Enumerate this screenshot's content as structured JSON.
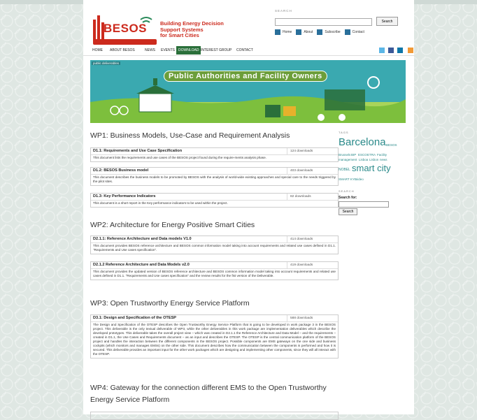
{
  "header": {
    "logo_text": "BESOS",
    "tagline_lines": [
      "Building Energy Decision",
      "Support Systems",
      "for Smart Cities"
    ],
    "search_label": "SEARCH",
    "search_button": "Search",
    "links": [
      "Home",
      "About",
      "Subscribe",
      "Contact"
    ]
  },
  "nav": {
    "items": [
      "HOME",
      "ABOUT BESOS",
      "NEWS",
      "EVENTS",
      "DOWNLOAD",
      "INTEREST GROUP",
      "CONTACT"
    ],
    "active": "DOWNLOAD"
  },
  "banner": {
    "breadcrumb": "public deliverables",
    "title": "Public Authorities and Facility Owners"
  },
  "sections": [
    {
      "heading": "WP1: Business Models, Use-Case and Requirement Analysis",
      "docs": [
        {
          "title": "D1.1: Requirements and Use Case Specification",
          "downloads": "124 downloads",
          "desc": "This document lists the requirements and use cases of the BESOS project found during the require-ments analysis phase."
        },
        {
          "title": "D1.2: BESOS Business model",
          "downloads": "403 downloads",
          "desc": "This document describes the business models to be promoted by BESOS with the analysis of world-wide existing approaches and special care to the needs triggered by the pilot sites."
        },
        {
          "title": "D1.3: Key Performance Indicators",
          "downloads": "82 downloads",
          "desc": "This document is a short report in the Key performance indicators to be used within the project."
        }
      ]
    },
    {
      "heading": "WP2: Architecture for Energy Positive Smart Cities",
      "docs": [
        {
          "title": "D2.1.1: Reference Architecture and Data models V1.0",
          "downloads": "414 downloads",
          "desc": "This document provides BESOS reference architecture and BESOS common information model taking into account requirements and related use cases defined in D1.1. \"Requirements and Use cases specification\"."
        },
        {
          "title": "D2.1.2 Reference Architecture and Data Models v2.0",
          "downloads": "419 downloads",
          "desc": "This document provides the updated version of BESOS reference architecture and BESOS common information model taking into account requirements and related use cases defined in D1.1. \"Requirements and Use cases specification\" and the review results for the fist version of the Deliverable."
        }
      ]
    },
    {
      "heading": "WP3: Open Trustworthy Energy Service Platform",
      "docs": [
        {
          "title": "D3.1: Design and Specification of the OTESP",
          "downloads": "588 downloads",
          "desc": "The Design and Specification of the OTESP describes the Open Trustworthy Energy Service Platform that is going to be developed in work package 3 in the BESOS project. This deliverable is the only textual deliverable of WP3, while the other deliverables in this work package are implementation deliverables which describe the developed prototypes. This deliverable takes the overall project view – which was created in D2.1.1 the Reference Architecture and Data Model – and the requirements – created in D1.1, the Use Cases and Requirements document – as an input and describes the OTESP. The OTESP is the central communication platform of the BESOS project and handles the interaction between the different components in the BESOS project. Possible components are EMS gateways on the one side and business cockpits (which monitors and manages EMSs) on the other side. This document describes how the communication between the components is performed and how it is secured. This deliverable provides an important input for the other work packages which are designing and implementing other components, since they will all interact with the OTESP."
        }
      ]
    },
    {
      "heading_lines": [
        "WP4: Gateway for the connection different EMS to the Open Trustworthy",
        "Energy Service Platform"
      ]
    }
  ],
  "sidebar": {
    "tags_heading": "TAGS",
    "tags": [
      {
        "text": "Barcelona",
        "size": "big"
      },
      {
        "text": "BESOS",
        "size": "small"
      },
      {
        "text": "Brussels",
        "size": "small"
      },
      {
        "text": "BIP",
        "size": "small"
      },
      {
        "text": "ESCO",
        "size": "small"
      },
      {
        "text": "ETRA",
        "size": "small"
      },
      {
        "text": "Facility",
        "size": "small"
      },
      {
        "text": "management",
        "size": "small"
      },
      {
        "text": "Lisboa",
        "size": "small"
      },
      {
        "text": "Lisbon",
        "size": "small"
      },
      {
        "text": "news",
        "size": "small"
      },
      {
        "text": "NOBEL",
        "size": "small"
      },
      {
        "text": "smart city",
        "size": "big"
      },
      {
        "text": "SMART KYE",
        "size": "small"
      },
      {
        "text": "video",
        "size": "small"
      }
    ],
    "search_heading": "SEARCH",
    "search_for": "Search for:",
    "search_button": "Search"
  },
  "colors": {
    "accent_red": "#cc2a1d",
    "nav_active": "#2a6f3a",
    "banner_bg": "#3aa9b0",
    "tag_color": "#2a8a8a"
  }
}
